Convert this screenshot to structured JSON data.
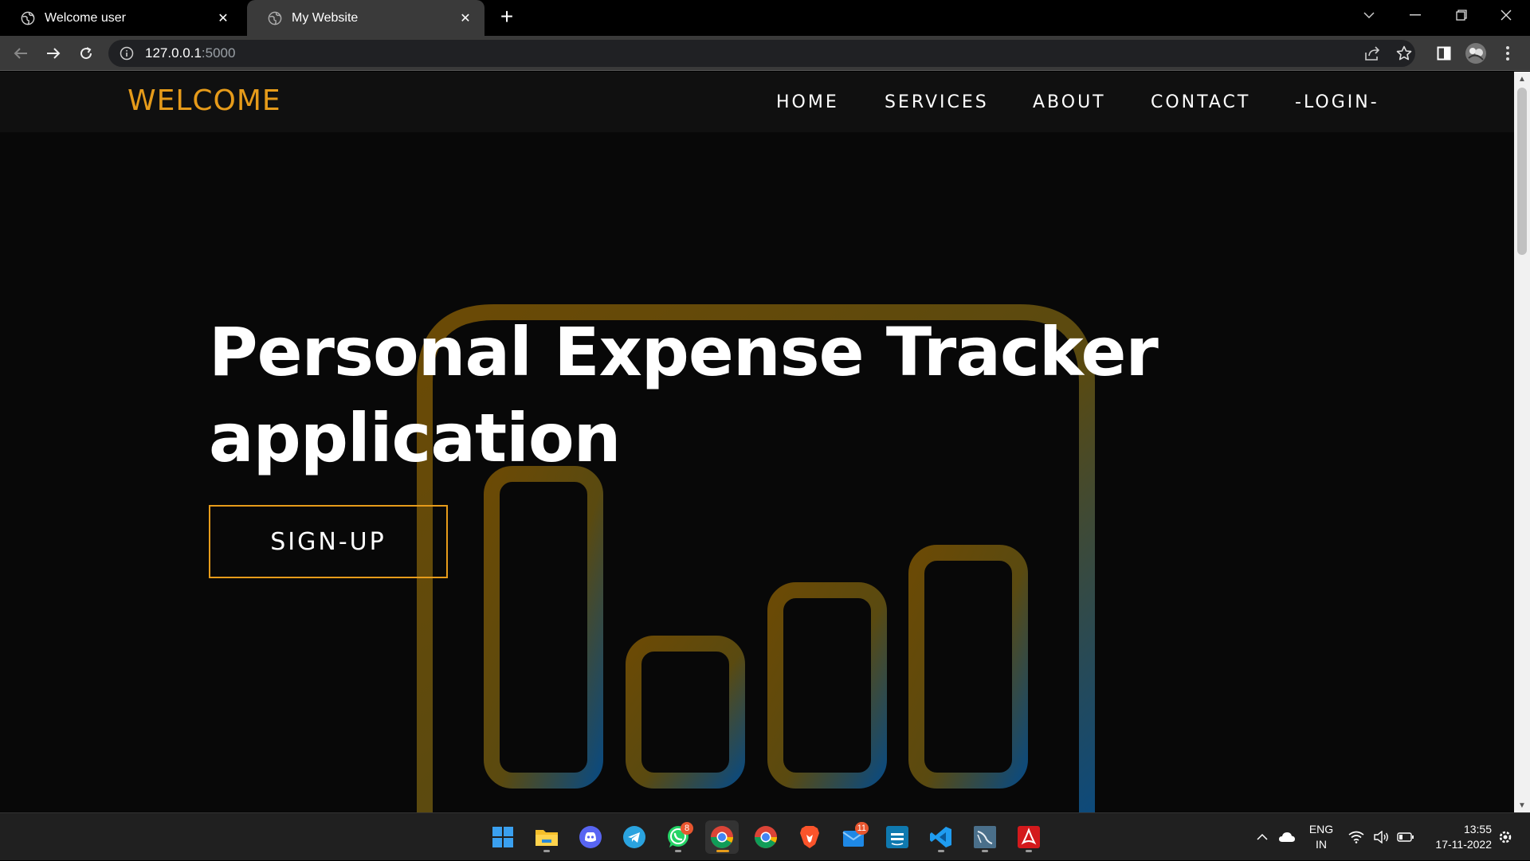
{
  "browser": {
    "tabs": [
      {
        "title": "Welcome user",
        "active": false
      },
      {
        "title": "My Website",
        "active": true
      }
    ],
    "address": {
      "host": "127.0.0.1",
      "port": ":5000"
    }
  },
  "site": {
    "brand": "WELCOME",
    "nav": [
      "HOME",
      "SERVICES",
      "ABOUT",
      "CONTACT",
      "-LOGIN-"
    ],
    "hero": {
      "title_line1": "Personal Expense Tracker",
      "title_line2": "application",
      "cta": "SIGN-UP"
    },
    "colors": {
      "accent": "#e69b1a",
      "background": "#080808",
      "navbar": "#101010"
    }
  },
  "taskbar": {
    "apps": [
      "start",
      "file-explorer",
      "discord",
      "telegram",
      "whatsapp",
      "chrome",
      "chrome",
      "brave",
      "mail",
      "prime-video",
      "vscode",
      "mysql-workbench",
      "acrobat"
    ],
    "badges": {
      "whatsapp": "8",
      "mail": "11"
    },
    "language": "ENG",
    "region": "IN",
    "time": "13:55",
    "date": "17-11-2022"
  }
}
